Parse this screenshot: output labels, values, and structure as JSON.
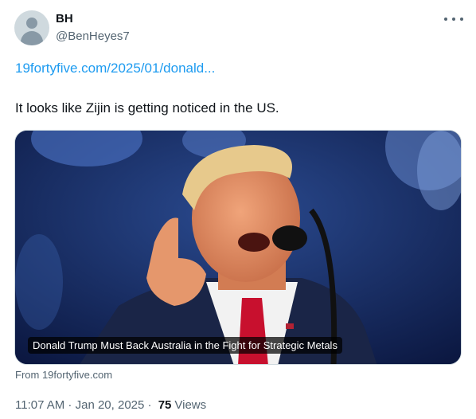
{
  "author": {
    "name": "BH",
    "handle": "@BenHeyes7"
  },
  "tweet": {
    "link_text": "19fortyfive.com/2025/01/donald...",
    "text": "It looks like Zijin is getting noticed in the US."
  },
  "card": {
    "title": "Donald Trump Must Back Australia in the Fight for Strategic Metals",
    "source": "From 19fortyfive.com"
  },
  "meta": {
    "time": "11:07 AM",
    "separator1": " · ",
    "date": "Jan 20, 2025",
    "separator2": " · ",
    "views_count": "75",
    "views_label": "Views"
  },
  "icons": {
    "avatar": "default-avatar-icon",
    "more": "more-options-icon"
  }
}
